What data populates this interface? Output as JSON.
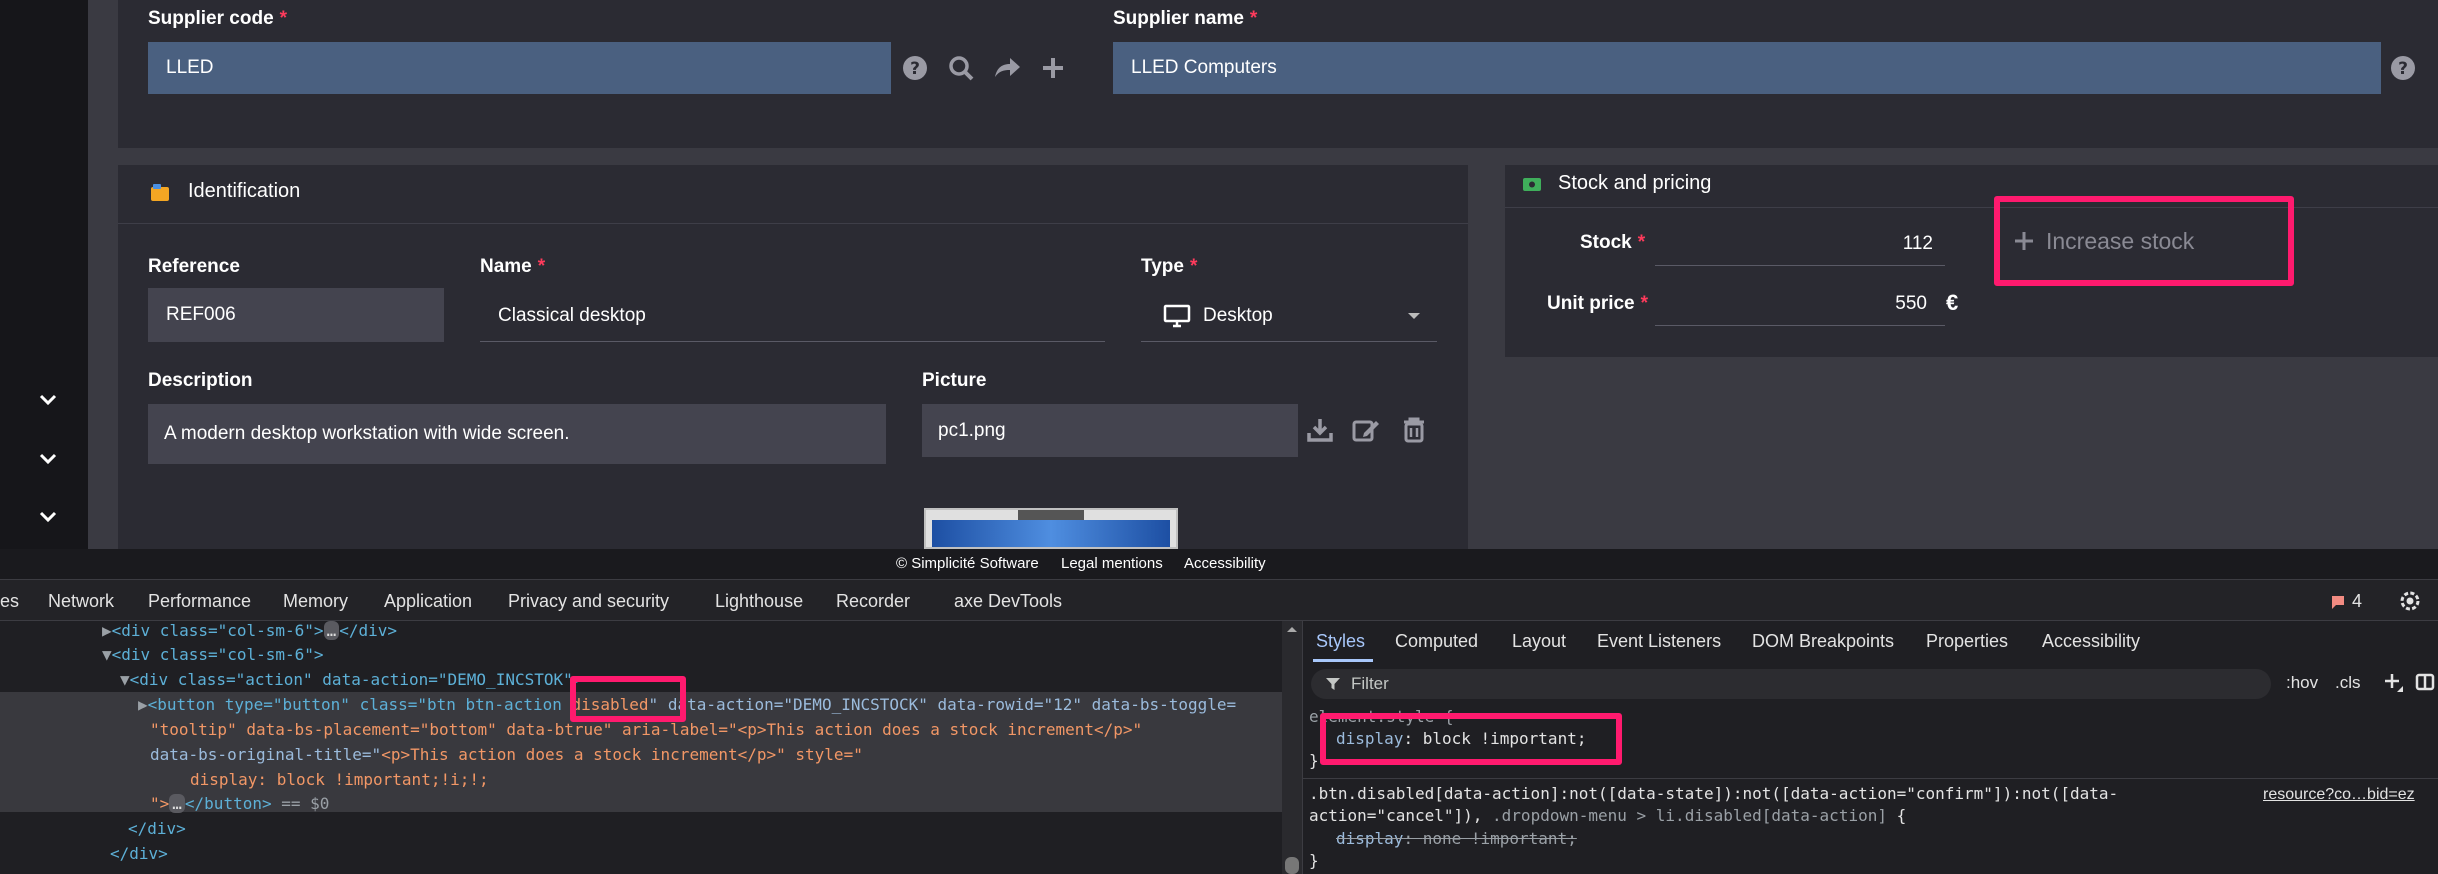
{
  "form": {
    "supplier_code": {
      "label": "Supplier code",
      "required": "*",
      "value": "LLED"
    },
    "supplier_name": {
      "label": "Supplier name",
      "required": "*",
      "value": "LLED Computers"
    },
    "identification": {
      "title": "Identification",
      "reference": {
        "label": "Reference",
        "value": "REF006"
      },
      "name": {
        "label": "Name",
        "required": "*",
        "value": "Classical desktop"
      },
      "type": {
        "label": "Type",
        "required": "*",
        "value": "Desktop"
      },
      "description": {
        "label": "Description",
        "value": "A modern desktop workstation with wide screen."
      },
      "picture": {
        "label": "Picture",
        "value": "pc1.png"
      }
    },
    "stock_pricing": {
      "title": "Stock and pricing",
      "stock": {
        "label": "Stock",
        "required": "*",
        "value": "112"
      },
      "unit_price": {
        "label": "Unit price",
        "required": "*",
        "value": "550",
        "currency": "€"
      },
      "increase_button": {
        "label": "Increase stock"
      }
    }
  },
  "footer": {
    "copyright": "© Simplicité Software",
    "legal": "Legal mentions",
    "accessibility": "Accessibility"
  },
  "devtools": {
    "tabs": [
      "es",
      "Network",
      "Performance",
      "Memory",
      "Application",
      "Privacy and security",
      "Lighthouse",
      "Recorder",
      "axe DevTools"
    ],
    "issues_count": "4",
    "elements": {
      "l1_open": "<div class=\"col-sm-6\">",
      "l1_ellipsis": "…",
      "l1_close": "</div>",
      "l2": "<div class=\"col-sm-6\">",
      "l3_a": "<div class=\"action\" data-action=\"DEMO_INCSTO",
      "l3_b": "K\">",
      "l4_a": "<button type=\"button\" class=\"btn btn-action ",
      "l4_b": "disabled",
      "l4_c": "\" data-action=\"DEMO_INCSTOCK\" data-rowid=\"12\" data-bs-toggle=",
      "l5_a": "\"tooltip\" data-bs-placement=\"bottom\" data-b",
      "l5_b": "true\" aria-label=\"",
      "l5_c": "<p>This action does a stock increment</p>\"",
      "l6_a": "data-bs-original-title=\"",
      "l6_b": "<p>This action does a stock increment</p>\" style=\"",
      "l7": "display: block !important;!i;!;",
      "l8_a": "\">",
      "l8_b": "</button>",
      "l8_c": " == $0",
      "l9": "</div>",
      "l10": "</div>"
    },
    "styles": {
      "tabs": [
        "Styles",
        "Computed",
        "Layout",
        "Event Listeners",
        "DOM Breakpoints",
        "Properties",
        "Accessibility"
      ],
      "filter_placeholder": "Filter",
      "hov": ":hov",
      "cls": ".cls",
      "element_style": "element.style {",
      "rule1_prop": "display",
      "rule1_value": "block !important;",
      "rule1_close": "}",
      "selector_line1": ".btn.disabled[data-action]:not([data-state]):not([data-action=\"confirm\"]):not([data-",
      "selector_line2a": "action=\"cancel\"]), ",
      "selector_line2b": ".dropdown-menu > li.disabled[data-action]",
      "selector_line2c": " {",
      "rule2_prop": "display",
      "rule2_value": "none !important;",
      "rule2_close": "}",
      "source": "resource?co…bid=ez"
    }
  },
  "colors": {
    "highlight": "#ff1a6e",
    "required": "#ff3b5c",
    "blue_input": "#4a6080"
  }
}
